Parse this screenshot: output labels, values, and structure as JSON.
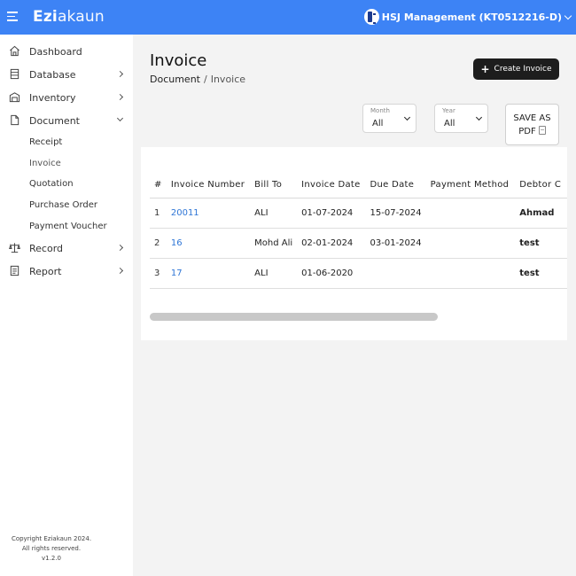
{
  "app": {
    "brand_bold": "Ezi",
    "brand_rest": "akaun",
    "company": "HSJ Management (KT0512216-D)"
  },
  "sidebar": {
    "items": [
      {
        "label": "Dashboard",
        "icon": "home-icon"
      },
      {
        "label": "Database",
        "icon": "database-icon"
      },
      {
        "label": "Inventory",
        "icon": "inventory-icon"
      },
      {
        "label": "Document",
        "icon": "document-icon"
      },
      {
        "label": "Record",
        "icon": "scale-icon"
      },
      {
        "label": "Report",
        "icon": "report-icon"
      }
    ],
    "document_sub": [
      "Receipt",
      "Invoice",
      "Quotation",
      "Purchase Order",
      "Payment Voucher"
    ],
    "footer": [
      "Copyright Eziakaun 2024.",
      "All rights reserved.",
      "v1.2.0"
    ]
  },
  "page": {
    "title": "Invoice",
    "breadcrumb": [
      "Document",
      "/",
      "Invoice"
    ],
    "create_label": "Create Invoice"
  },
  "filters": {
    "month": {
      "caption": "Month",
      "value": "All"
    },
    "year": {
      "caption": "Year",
      "value": "All"
    },
    "save_pdf": [
      "SAVE AS",
      "PDF"
    ]
  },
  "table": {
    "headers": [
      "#",
      "Invoice Number",
      "Bill To",
      "Invoice Date",
      "Due Date",
      "Payment Method",
      "Debtor C"
    ],
    "rows": [
      [
        "1",
        "20011",
        "ALI",
        "01-07-2024",
        "15-07-2024",
        "",
        "Ahmad"
      ],
      [
        "2",
        "16",
        "Mohd Ali",
        "02-01-2024",
        "03-01-2024",
        "",
        "test"
      ],
      [
        "3",
        "17",
        "ALI",
        "01-06-2020",
        "",
        "",
        "test"
      ]
    ]
  },
  "colors": {
    "topbar": "#3d83f5",
    "link": "#2f76d6",
    "button": "#1d1d1d"
  }
}
